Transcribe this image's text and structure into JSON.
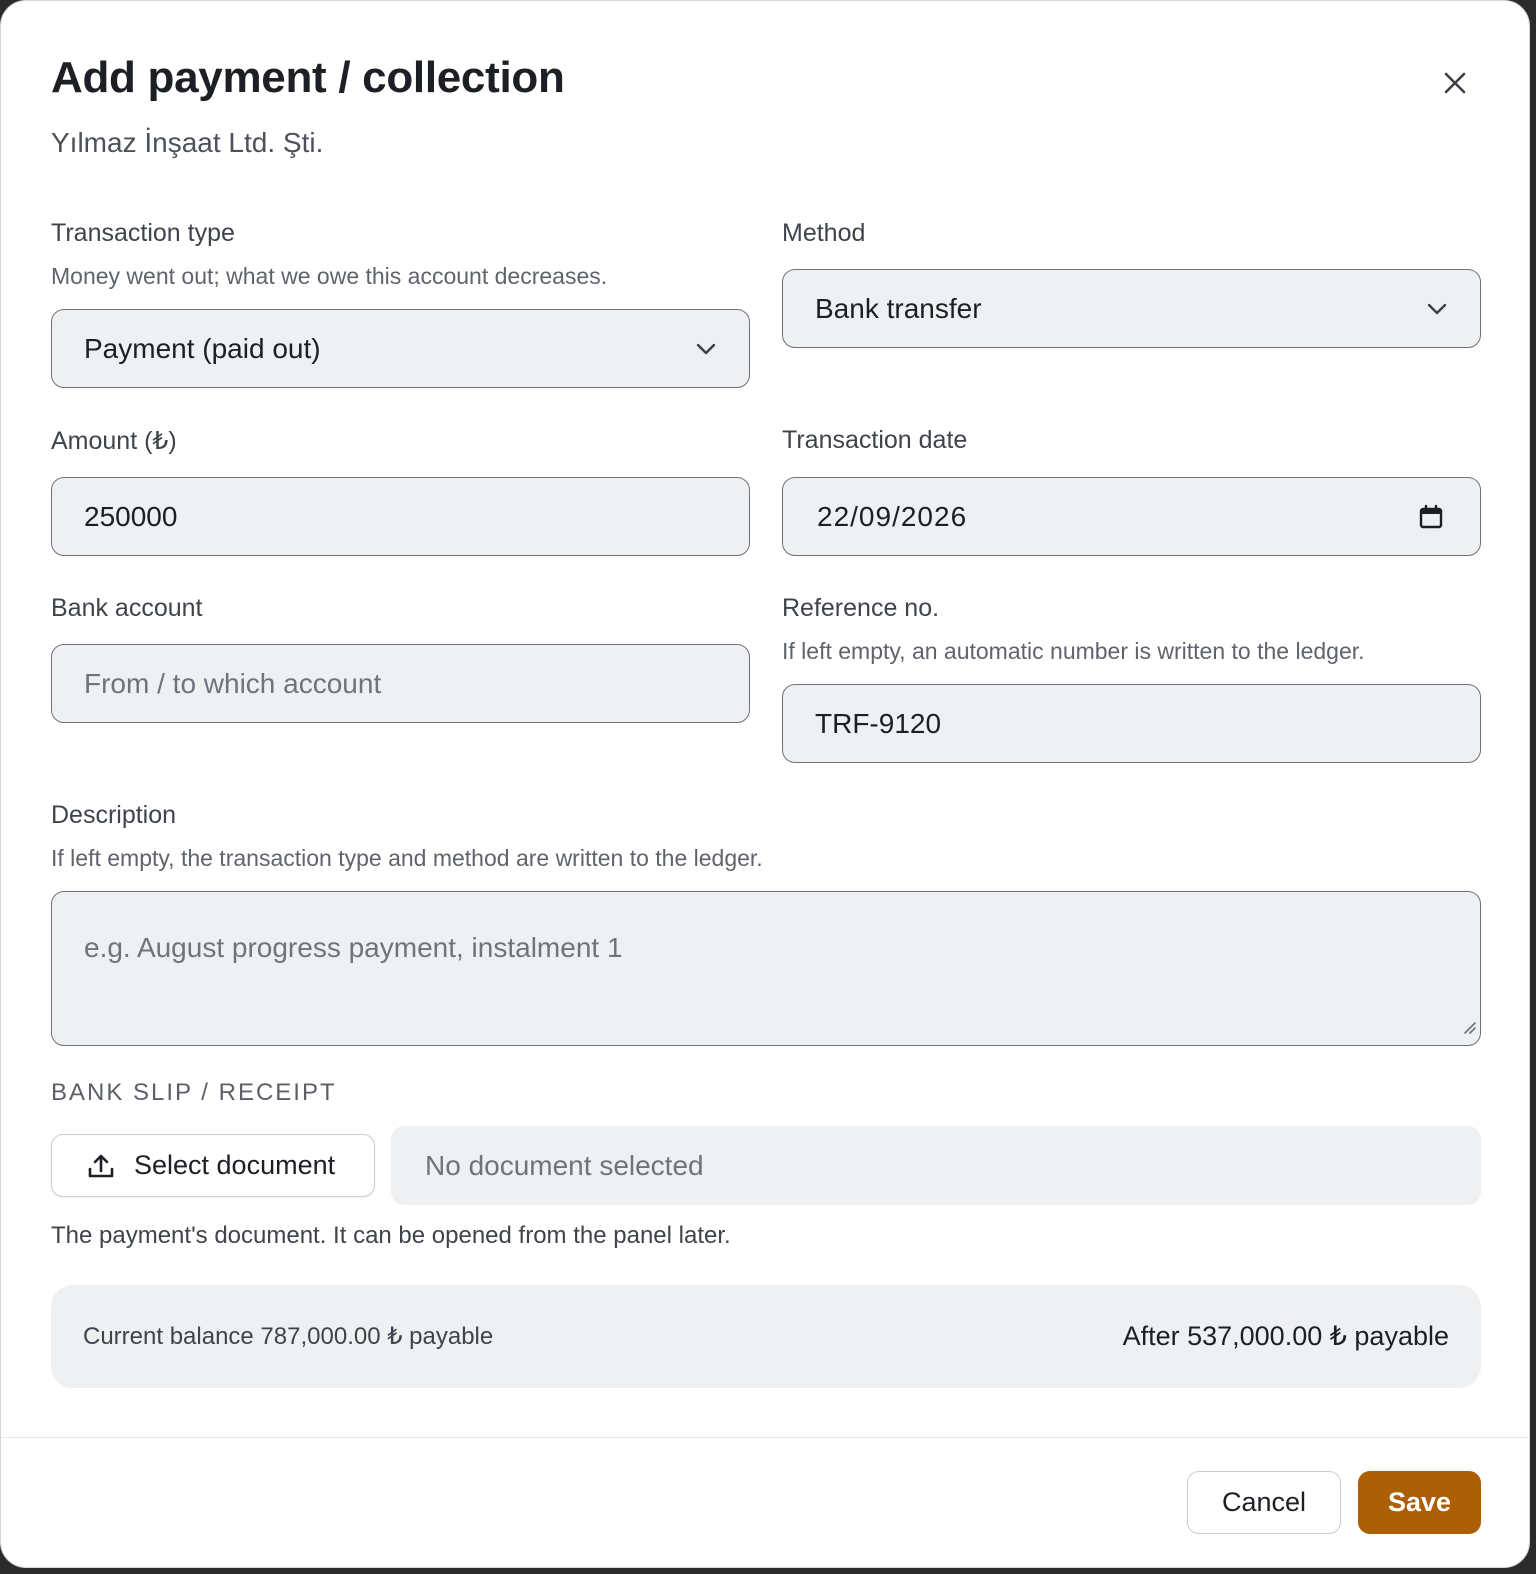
{
  "dialog": {
    "title": "Add payment / collection",
    "subtitle": "Yılmaz İnşaat Ltd. Şti."
  },
  "icons": {
    "close": "close-icon",
    "chevron": "chevron-down-icon",
    "calendar": "calendar-icon",
    "upload": "upload-icon"
  },
  "transaction_type": {
    "label": "Transaction type",
    "hint": "Money went out; what we owe this account decreases.",
    "value": "Payment (paid out)"
  },
  "method": {
    "label": "Method",
    "value": "Bank transfer"
  },
  "amount": {
    "label": "Amount (₺)",
    "value": "250000"
  },
  "transaction_date": {
    "label": "Transaction date",
    "value": "22/09/2026"
  },
  "bank_account": {
    "label": "Bank account",
    "placeholder": "From / to which account"
  },
  "reference": {
    "label": "Reference no.",
    "hint": "If left empty, an automatic number is written to the ledger.",
    "value": "TRF-9120"
  },
  "description": {
    "label": "Description",
    "hint": "If left empty, the transaction type and method are written to the ledger.",
    "placeholder": "e.g. August progress payment, instalment 1"
  },
  "attachment": {
    "section_label": "BANK SLIP / RECEIPT",
    "button_label": "Select document",
    "status": "No document selected",
    "hint": "The payment's document. It can be opened from the panel later."
  },
  "balance": {
    "current": "Current balance 787,000.00 ₺ payable",
    "after": "After 537,000.00 ₺ payable"
  },
  "footer": {
    "cancel_label": "Cancel",
    "save_label": "Save"
  },
  "colors": {
    "accent": "#ad5f06",
    "field_bg": "#eff0f2",
    "field_border": "#6e737b"
  }
}
